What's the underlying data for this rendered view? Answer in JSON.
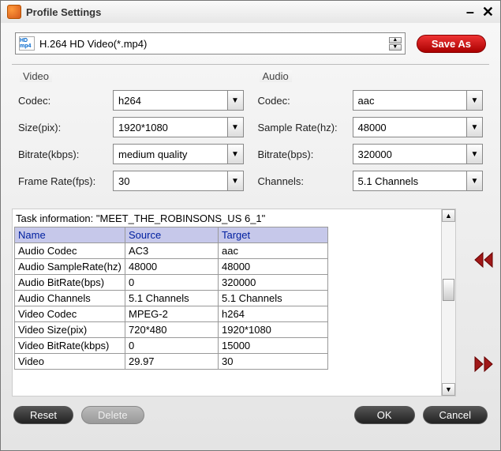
{
  "titlebar": {
    "title": "Profile Settings"
  },
  "profile": {
    "format_icon": "HD mp4",
    "value": "H.264 HD Video(*.mp4)",
    "saveas": "Save As"
  },
  "video": {
    "header": "Video",
    "codec_label": "Codec:",
    "codec_value": "h264",
    "size_label": "Size(pix):",
    "size_value": "1920*1080",
    "bitrate_label": "Bitrate(kbps):",
    "bitrate_value": "medium quality",
    "framerate_label": "Frame Rate(fps):",
    "framerate_value": "30"
  },
  "audio": {
    "header": "Audio",
    "codec_label": "Codec:",
    "codec_value": "aac",
    "samplerate_label": "Sample Rate(hz):",
    "samplerate_value": "48000",
    "bitrate_label": "Bitrate(bps):",
    "bitrate_value": "320000",
    "channels_label": "Channels:",
    "channels_value": "5.1 Channels"
  },
  "task": {
    "header": "Task information: \"MEET_THE_ROBINSONS_US 6_1\"",
    "columns": {
      "name": "Name",
      "source": "Source",
      "target": "Target"
    },
    "rows": [
      {
        "name": "Audio Codec",
        "source": "AC3",
        "target": "aac"
      },
      {
        "name": "Audio SampleRate(hz)",
        "source": "48000",
        "target": "48000"
      },
      {
        "name": "Audio BitRate(bps)",
        "source": "0",
        "target": "320000"
      },
      {
        "name": "Audio Channels",
        "source": "5.1 Channels",
        "target": "5.1 Channels"
      },
      {
        "name": "Video Codec",
        "source": "MPEG-2",
        "target": "h264"
      },
      {
        "name": "Video Size(pix)",
        "source": "720*480",
        "target": "1920*1080"
      },
      {
        "name": "Video BitRate(kbps)",
        "source": "0",
        "target": "15000"
      },
      {
        "name": "Video",
        "source": "29.97",
        "target": "30"
      }
    ]
  },
  "buttons": {
    "reset": "Reset",
    "delete": "Delete",
    "ok": "OK",
    "cancel": "Cancel"
  }
}
